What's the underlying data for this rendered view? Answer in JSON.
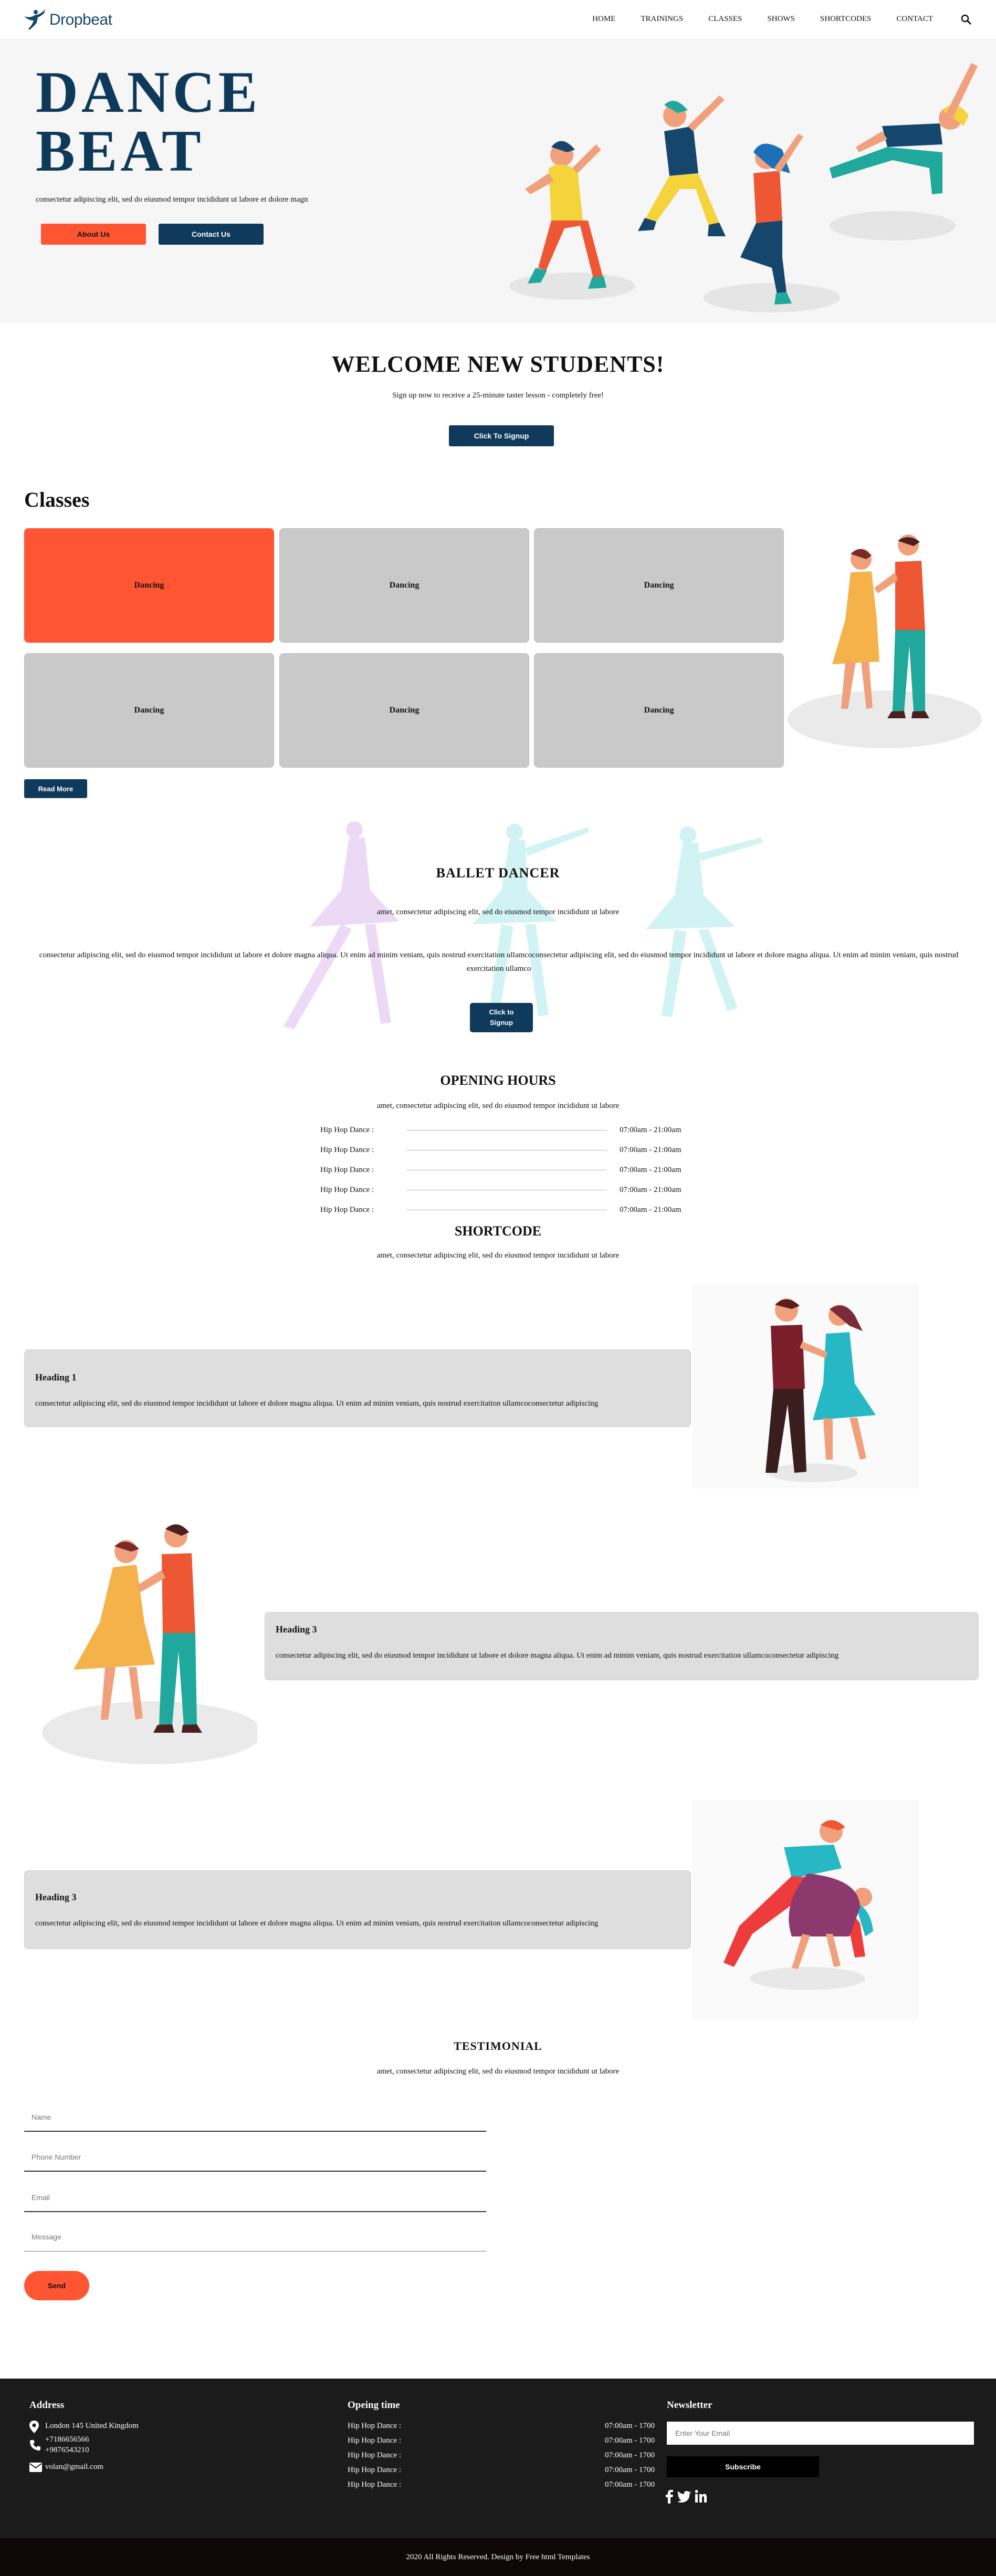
{
  "header": {
    "brand": "Dropbeat",
    "nav": [
      "HOME",
      "TRAININGS",
      "CLASSES",
      "SHOWS",
      "SHORTCODES",
      "CONTACT"
    ]
  },
  "hero": {
    "title_line1": "DANCE",
    "title_line2": "BEAT",
    "subtitle": "consectetur adipiscing elit, sed do eiusmod tempor incididunt ut labore et dolore magn",
    "about_button": "About Us",
    "contact_button": "Contact Us"
  },
  "welcome": {
    "title": "WELCOME NEW STUDENTS!",
    "subtitle": "Sign up now to receive a 25-minute taster lesson - completely free!",
    "button": "Click To Signup"
  },
  "classes": {
    "title": "Classes",
    "cards": [
      "Dancing",
      "Dancing",
      "Dancing",
      "Dancing",
      "Dancing",
      "Dancing"
    ],
    "read_more": "Read More"
  },
  "ballet": {
    "title": "BALLET DANCER",
    "subtitle": "amet, consectetur adipiscing elit, sed do eiusmod tempor incididunt ut labore",
    "body": "consectetur adipiscing elit, sed do eiusmod tempor incididunt ut labore et dolore magna aliqua. Ut enim ad minim veniam, quis nostrud exercitation ullamcoconsectetur adipiscing elit, sed do eiusmod tempor incididunt ut labore et dolore magna aliqua. Ut enim ad minim veniam, quis nostrud exercitation ullamco",
    "button_line1": "Click to",
    "button_line2": "Signup"
  },
  "hours": {
    "title": "OPENING HOURS",
    "subtitle": "amet, consectetur adipiscing elit, sed do eiusmod tempor incididunt ut labore",
    "rows": [
      {
        "day": "Hip Hop Dance :",
        "time": "07:00am - 21:00am"
      },
      {
        "day": "Hip Hop Dance :",
        "time": "07:00am - 21:00am"
      },
      {
        "day": "Hip Hop Dance :",
        "time": "07:00am - 21:00am"
      },
      {
        "day": "Hip Hop Dance :",
        "time": "07:00am - 21:00am"
      },
      {
        "day": "Hip Hop Dance :",
        "time": "07:00am - 21:00am"
      }
    ]
  },
  "shortcode": {
    "title": "SHORTCODE",
    "subtitle": "amet, consectetur adipiscing elit, sed do eiusmod tempor incididunt ut labore",
    "items": [
      {
        "heading": "Heading 1",
        "text": "consectetur adipiscing elit, sed do eiusmod tempor incididunt ut labore et dolore magna aliqua. Ut enim ad minim veniam, quis nostrud exercitation ullamcoconsectetur adipiscing"
      },
      {
        "heading": "Heading 3",
        "text": "consectetur adipiscing elit, sed do eiusmod tempor incididunt ut labore et dolore magna aliqua. Ut enim ad minim veniam, quis nostrud exercitation ullamcoconsectetur adipiscing"
      },
      {
        "heading": "Heading 3",
        "text": "consectetur adipiscing elit, sed do eiusmod tempor incididunt ut labore et dolore magna aliqua. Ut enim ad minim veniam, quis nostrud exercitation ullamcoconsectetur adipiscing"
      }
    ]
  },
  "testimonial": {
    "title": "TESTIMONIAL",
    "subtitle": "amet, consectetur adipiscing elit, sed do eiusmod tempor incididunt ut labore",
    "form": {
      "name": "Name",
      "phone": "Phone Number",
      "email": "Email",
      "message": "Message",
      "send": "Send"
    }
  },
  "footer": {
    "address_title": "Address",
    "address": "London 145 United Kingdom",
    "phone1": "+7186656566",
    "phone2": "+9876543210",
    "email": "volan@gmail.com",
    "hours_title": "Opeing time",
    "hours": [
      {
        "day": "Hip Hop Dance :",
        "time": "07:00am - 1700"
      },
      {
        "day": "Hip Hop Dance :",
        "time": "07:00am - 1700"
      },
      {
        "day": "Hip Hop Dance :",
        "time": "07:00am - 1700"
      },
      {
        "day": "Hip Hop Dance :",
        "time": "07:00am - 1700"
      },
      {
        "day": "Hip Hop Dance :",
        "time": "07:00am - 1700"
      }
    ],
    "newsletter_title": "Newsletter",
    "newsletter_placeholder": "Enter Your Email",
    "subscribe": "Subscribe",
    "social_icons": [
      "facebook-icon",
      "twitter-icon",
      "linkedin-icon"
    ]
  },
  "copyright": "2020 All Rights Reserved. Design by Free html Templates",
  "colors": {
    "navy": "#0f3a5c",
    "orange": "#ff5533",
    "card_grey": "#c9c9c9",
    "footer": "#1b1b1b"
  }
}
